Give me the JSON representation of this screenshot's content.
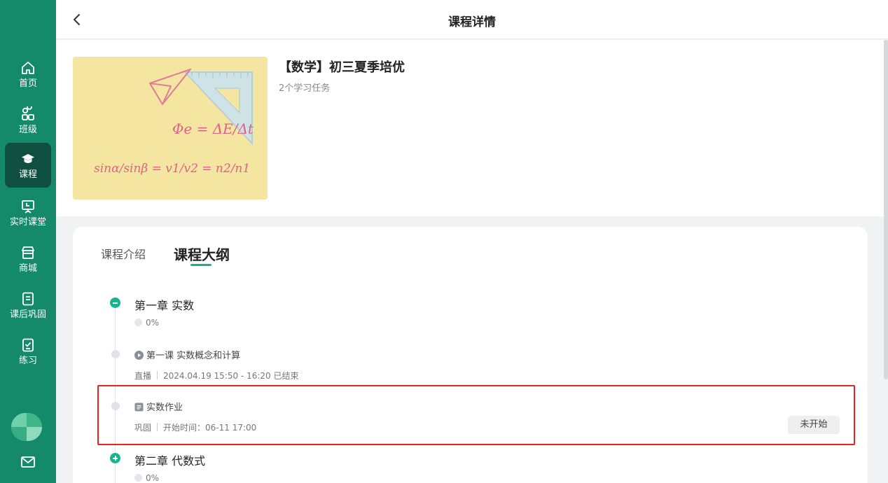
{
  "sidebar": {
    "items": [
      {
        "label": "首页",
        "icon": "home-icon",
        "active": false
      },
      {
        "label": "班级",
        "icon": "users-icon",
        "active": false
      },
      {
        "label": "课程",
        "icon": "graduation-cap-icon",
        "active": true
      },
      {
        "label": "实时课堂",
        "icon": "presentation-board-icon",
        "active": false
      },
      {
        "label": "商城",
        "icon": "store-icon",
        "active": false
      },
      {
        "label": "课后巩固",
        "icon": "notebook-icon",
        "active": false
      },
      {
        "label": "练习",
        "icon": "checklist-icon",
        "active": false
      }
    ],
    "bottom_icons": [
      "avatar",
      "mail-icon"
    ]
  },
  "header": {
    "title": "课程详情"
  },
  "course": {
    "title": "【数学】初三夏季培优",
    "subtitle": "2个学习任务",
    "thumbnail_formulas": [
      "Φe = ΔE/Δt",
      "sinα/sinβ = v1/v2 = n2/n1"
    ]
  },
  "tabs": {
    "intro": "课程介绍",
    "outline": "课程大纲",
    "active": "outline"
  },
  "outline": {
    "chapter1": {
      "title": "第一章 实数",
      "progress": "0%"
    },
    "lesson1": {
      "title": "第一课 实数概念和计算",
      "type": "直播",
      "time": "2024.04.19 15:50 - 16:20 已结束"
    },
    "homework": {
      "title": "实数作业",
      "type": "巩固",
      "start_time": "开始时间：06-11 17:00",
      "status": "未开始"
    },
    "chapter2": {
      "title": "第二章 代数式",
      "progress": "0%"
    }
  },
  "colors": {
    "sidebar": "#148a6a",
    "sidebar_active": "#0e4f40",
    "accent": "#1bb08a",
    "highlight": "#e8231e"
  }
}
